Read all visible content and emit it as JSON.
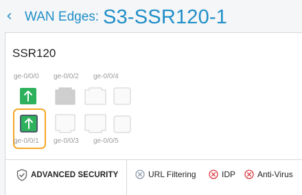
{
  "header": {
    "breadcrumb_parent": "WAN Edges:",
    "title": "S3-SSR120-1"
  },
  "device": {
    "name": "SSR120",
    "ports": [
      {
        "label": "ge-0/0/0",
        "status": "up"
      },
      {
        "label": "ge-0/0/1",
        "status": "up",
        "selected": true
      },
      {
        "label": "ge-0/0/2",
        "status": "disabled"
      },
      {
        "label": "ge-0/0/3",
        "status": "empty"
      },
      {
        "label": "ge-0/0/4",
        "status": "empty"
      },
      {
        "label": "ge-0/0/5",
        "status": "empty"
      }
    ]
  },
  "security": {
    "label": "ADVANCED SECURITY",
    "features": [
      {
        "label": "URL Filtering",
        "state": "disabled-gray"
      },
      {
        "label": "IDP",
        "state": "disabled-red"
      },
      {
        "label": "Anti-Virus",
        "state": "disabled-red"
      }
    ]
  },
  "colors": {
    "accent": "#1f8ec9",
    "port_up": "#2db15c",
    "selection": "#f5a623",
    "disabled_red": "#d9363e"
  }
}
